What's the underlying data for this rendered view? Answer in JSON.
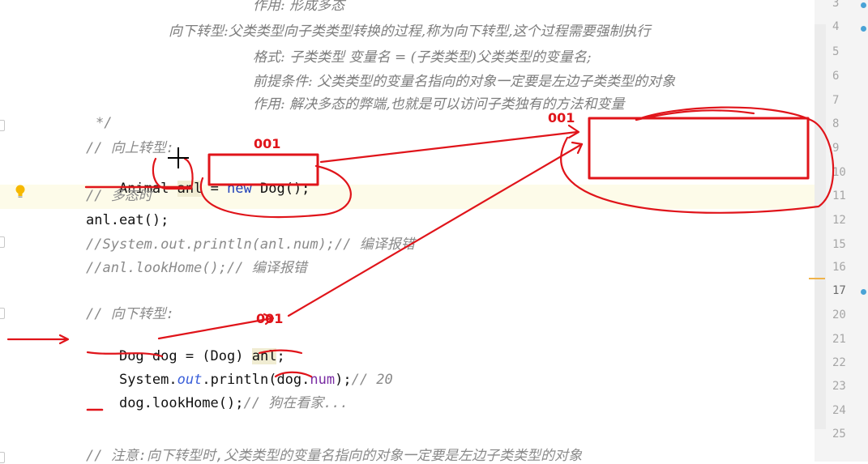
{
  "doc_comment": {
    "line1": "作用: 形成多态",
    "line2": "向下转型:父类类型向子类类型转换的过程,称为向下转型,这个过程需要强制执行",
    "line3": "格式: 子类类型 变量名 = (子类类型)父类类型的变量名;",
    "line4": "前提条件: 父类类型的变量名指向的对象一定要是左边子类类型的对象",
    "line5": "作用: 解决多态的弊端,也就是可以访问子类独有的方法和变量",
    "close": "*/"
  },
  "code": {
    "c_upcast": "// 向上转型:",
    "l_animal_type": "Animal ",
    "l_animal_var": "anl",
    "l_animal_eq": " = ",
    "l_animal_new": "new",
    "l_animal_rest": " Dog();",
    "c_poly": "// 多态时",
    "l_eat": "anl.eat();",
    "c_sysout": "//System.out.println(anl.num);// 编译报错",
    "c_lookhome": "//anl.lookHome();// 编译报错",
    "c_downcast": "// 向下转型:",
    "l_dog_a": "Dog dog = (Dog) ",
    "l_dog_var": "anl",
    "l_dog_end": ";",
    "l_print_a": "System.",
    "l_print_out": "out",
    "l_print_b": ".println(dog.",
    "l_print_num": "num",
    "l_print_c": ");",
    "l_print_cmt": "// 20",
    "l_look": "dog.lookHome();",
    "l_look_cmt": "// 狗在看家...",
    "c_note": "// 注意:向下转型时,父类类型的变量名指向的对象一定要是左边子类类型的对象"
  },
  "line_numbers": [
    "3",
    "4",
    "5",
    "6",
    "7",
    "8",
    "9",
    "10",
    "11",
    "12",
    "15",
    "16",
    "17",
    "20",
    "21",
    "22",
    "23",
    "24",
    "25"
  ],
  "annotations": {
    "a1": "001",
    "a2": "001",
    "a3": "001"
  },
  "colors": {
    "annotation_red": "#e0141a",
    "keyword_blue": "#1f3fb8",
    "field_purple": "#7a2da3",
    "comment_gray": "#8a8a8a"
  },
  "icons": [
    "lightbulb-icon",
    "breakpoint-dot-icon",
    "text-cursor-icon"
  ]
}
